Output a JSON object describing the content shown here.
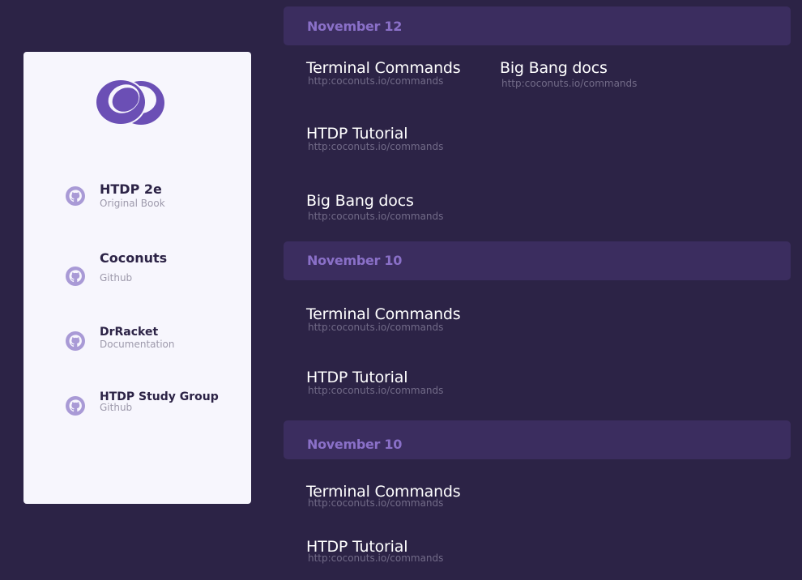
{
  "sidebar": {
    "items": [
      {
        "title": "HTDP 2e",
        "subtitle": "Original Book",
        "icon": "github-icon"
      },
      {
        "title": "Coconuts",
        "subtitle": "Github",
        "icon": "github-icon"
      },
      {
        "title": "DrRacket",
        "subtitle": "Documentation",
        "icon": "github-icon"
      },
      {
        "title": "HTDP Study Group",
        "subtitle": "Github",
        "icon": "github-icon"
      }
    ]
  },
  "sections": [
    {
      "date": "November 12",
      "links": [
        {
          "title": "Terminal Commands",
          "url": "http:coconuts.io/commands"
        },
        {
          "title": "Big Bang docs",
          "url": "http:coconuts.io/commands"
        },
        {
          "title": "HTDP Tutorial",
          "url": "http:coconuts.io/commands"
        },
        {
          "title": "Big Bang docs",
          "url": "http:coconuts.io/commands"
        }
      ]
    },
    {
      "date": "November 10",
      "links": [
        {
          "title": "Terminal Commands",
          "url": "http:coconuts.io/commands"
        },
        {
          "title": "HTDP Tutorial",
          "url": "http:coconuts.io/commands"
        }
      ]
    },
    {
      "date": "November 10",
      "links": [
        {
          "title": "Terminal Commands",
          "url": "http:coconuts.io/commands"
        },
        {
          "title": "HTDP Tutorial",
          "url": "http:coconuts.io/commands"
        }
      ]
    }
  ],
  "colors": {
    "background": "#2c2346",
    "sidebar": "#f7f6fd",
    "section_header": "#3b2d5f",
    "accent": "#8a70c8",
    "logo": "#6b4fb5"
  }
}
